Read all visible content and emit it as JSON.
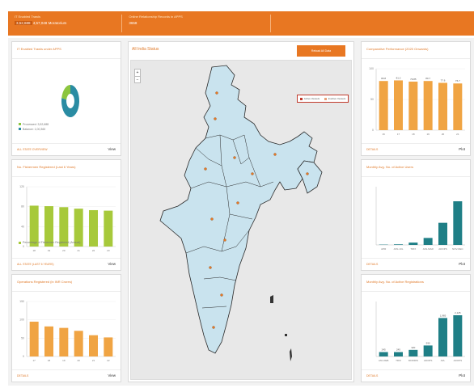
{
  "header": {
    "cell1_label": "IT Enabled Trawls",
    "cell1_value": "3,52,688",
    "cell1_value2": "4,57,048 Moratorium",
    "cell2_label": "Online Relationship Records in APPS",
    "cell2_value": "3658"
  },
  "cards": {
    "registered": {
      "title": "IT Enabled Trawls under APPS",
      "legend": [
        "Processed: 3,52,688",
        "Balance: 1,00,360"
      ],
      "foot": "ALL STATE OVERVIEW",
      "view_label": "View"
    },
    "statewise": {
      "title": "No. Fishermen Registered (Last 6 Years)",
      "legend": "Percentage of Fishermen Registered (Annual)",
      "foot": "ALL STATE (LAST 6 YEARS)",
      "view_label": "View"
    },
    "operations": {
      "title": "Operations Registered (in INR Crores)",
      "foot": "DETAILS",
      "view_label": "View"
    },
    "comparison": {
      "title": "Comparative Performance (2020 Onwards)",
      "foot": "DETAILS",
      "view_label": "Plot"
    },
    "monthly_top": {
      "title": "Monthly Avg. No. of Active Users",
      "foot": "DETAILS",
      "view_label": "Plot"
    },
    "monthly_bottom": {
      "title": "Monthly Avg. No. of Active Registrations",
      "foot": "DETAILS",
      "view_label": "Plot"
    }
  },
  "map": {
    "title": "All India Status",
    "button_label": "Reload All Data",
    "zoom_in": "+",
    "zoom_out": "−",
    "legend": [
      "Active Vessels",
      "Inactive Vessels"
    ],
    "colors": {
      "land": "#c9e3ee",
      "border": "#2a2a2a",
      "accent": "#e87722"
    }
  },
  "chart_data": [
    {
      "type": "pie",
      "id": "registered",
      "values": [
        78,
        22
      ],
      "colors": [
        "#2a8ca3",
        "#8cc63f"
      ]
    },
    {
      "type": "bar",
      "id": "statewise",
      "categories": [
        "18",
        "19",
        "20",
        "21",
        "22",
        "23"
      ],
      "values": [
        82,
        81,
        79,
        76,
        73,
        72
      ],
      "ylim": [
        0,
        120
      ],
      "yticks": [
        "0",
        "40",
        "80",
        "120"
      ],
      "color": "#a7c93b"
    },
    {
      "type": "bar",
      "id": "operations",
      "categories": [
        "17",
        "18",
        "19",
        "20",
        "21",
        "22"
      ],
      "values": [
        95,
        82,
        78,
        70,
        58,
        52
      ],
      "ylim": [
        0,
        150
      ],
      "yticks": [
        "0",
        "50",
        "100",
        "150"
      ],
      "color": "#f0a443"
    },
    {
      "type": "bar",
      "id": "comparison",
      "categories": [
        "16",
        "17",
        "18",
        "19",
        "20",
        "21"
      ],
      "values": [
        80,
        81,
        79,
        80,
        77,
        76
      ],
      "labels": [
        "80.8",
        "81.2",
        "79.85",
        "80.7",
        "77.6",
        "76.7"
      ],
      "ylim": [
        0,
        100
      ],
      "yticks": [
        "0",
        "50",
        "100"
      ],
      "color": "#f0a443"
    },
    {
      "type": "bar",
      "id": "monthly_top",
      "categories": [
        "APR",
        "JUN-JUL",
        "TRIX",
        "JAN-MAR",
        "ADOPS",
        "NOV-DEC"
      ],
      "values": [
        0.5,
        1,
        4,
        12,
        38,
        75
      ],
      "ylim": [
        0,
        100
      ],
      "color": "#1f7f86"
    },
    {
      "type": "bar",
      "id": "monthly_bottom",
      "categories": [
        "JAN-FEB",
        "TRIX",
        "MORRIS",
        "ADOPS",
        "AVL",
        "ADOPS"
      ],
      "values": [
        8,
        8,
        12,
        20,
        70,
        75
      ],
      "labels": [
        "245",
        "245",
        "320",
        "590",
        "1,985",
        "2,125"
      ],
      "ylim": [
        0,
        100
      ],
      "color": "#1f7f86"
    }
  ]
}
